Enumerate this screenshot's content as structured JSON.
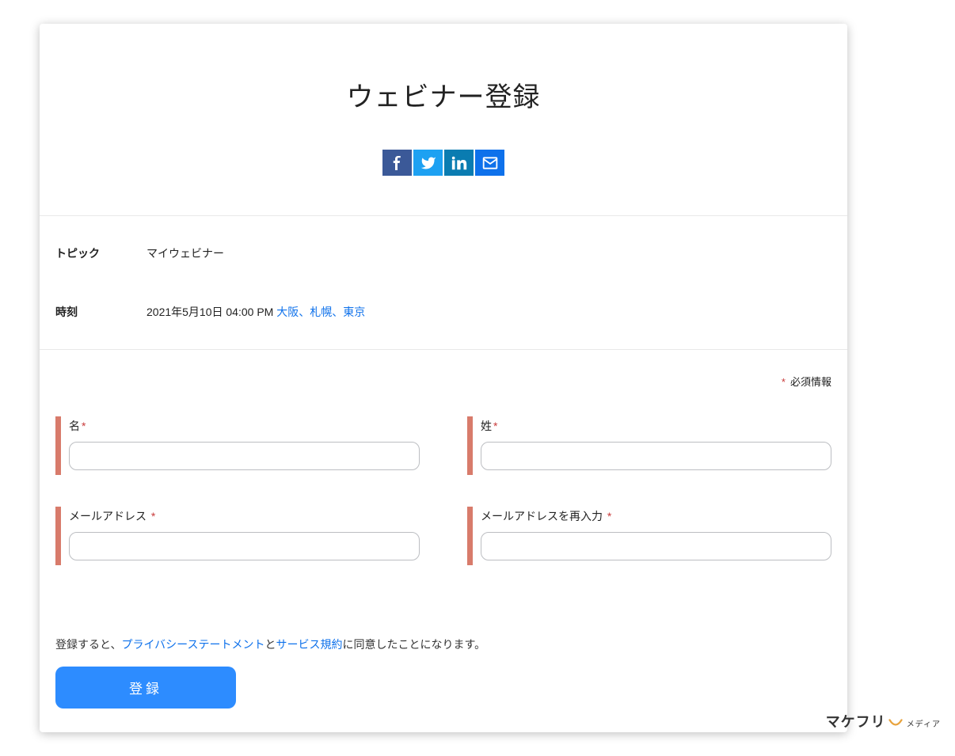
{
  "header": {
    "title": "ウェビナー登録"
  },
  "info": {
    "topic_label": "トピック",
    "topic_value": "マイウェビナー",
    "time_label": "時刻",
    "time_value": "2021年5月10日 04:00 PM ",
    "time_zone_link": "大阪、札幌、東京"
  },
  "required_note": {
    "star": "*",
    "text": "必須情報"
  },
  "fields": {
    "first_name": {
      "label": "名",
      "star": "*"
    },
    "last_name": {
      "label": "姓",
      "star": "*"
    },
    "email": {
      "label": "メールアドレス",
      "star": "*"
    },
    "email_confirm": {
      "label": "メールアドレスを再入力",
      "star": "*"
    }
  },
  "consent": {
    "prefix": "登録すると、",
    "privacy_link": "プライバシーステートメント",
    "mid1": "と",
    "tos_link": "サービス規約",
    "suffix": "に同意したことになります。"
  },
  "submit": {
    "label": "登録"
  },
  "footer": {
    "brand": "マケフリ",
    "sub": "メディア"
  }
}
